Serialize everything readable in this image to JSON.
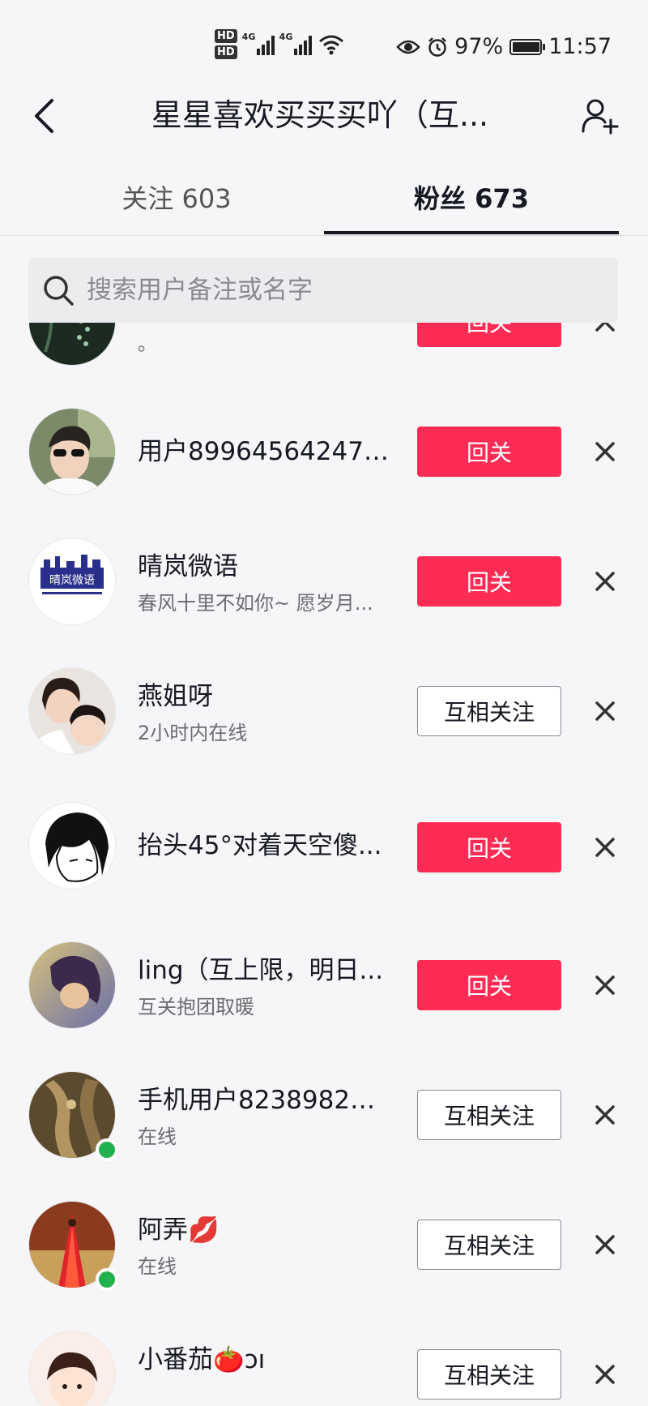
{
  "status_bar": {
    "hd1": "HD",
    "hd2": "HD",
    "net1": "4G",
    "net2": "4G",
    "battery_pct": "97%",
    "time": "11:57",
    "icons": [
      "eye-icon",
      "alarm-icon",
      "wifi-icon",
      "battery-icon"
    ]
  },
  "header": {
    "title": "星星喜欢买买买吖（互..."
  },
  "tabs": [
    {
      "label": "关注 603"
    },
    {
      "label": "粉丝 673"
    }
  ],
  "search": {
    "placeholder": "搜索用户备注或名字"
  },
  "followers": [
    {
      "name": "",
      "sub": "。",
      "action": "回关",
      "style": "red",
      "online": false
    },
    {
      "name": "用户8996456424730",
      "sub": "",
      "action": "回关",
      "style": "red",
      "online": false
    },
    {
      "name": "晴岚微语",
      "sub": "春风十里不如你~ 愿岁月...",
      "action": "回关",
      "style": "red",
      "online": false
    },
    {
      "name": "燕姐呀",
      "sub": "2小时内在线",
      "action": "互相关注",
      "style": "outline",
      "online": false
    },
    {
      "name": "抬头45°对着天空傻...",
      "sub": "",
      "action": "回关",
      "style": "red",
      "online": false
    },
    {
      "name": "ling（互上限，明日...",
      "sub": "互关抱团取暖",
      "action": "回关",
      "style": "red",
      "online": false
    },
    {
      "name": "手机用户82389829...",
      "sub": "在线",
      "action": "互相关注",
      "style": "outline",
      "online": true
    },
    {
      "name": "阿弄💋",
      "sub": "在线",
      "action": "互相关注",
      "style": "outline",
      "online": true
    },
    {
      "name": "小番茄🍅ɔı",
      "sub": "",
      "action": "互相关注",
      "style": "outline",
      "online": false
    }
  ],
  "avatar_logo_text": "晴岚微语",
  "colors": {
    "accent_red": "#fe2c55",
    "online_green": "#22b14c",
    "text_primary": "#161823",
    "text_secondary": "#6b6c72"
  }
}
